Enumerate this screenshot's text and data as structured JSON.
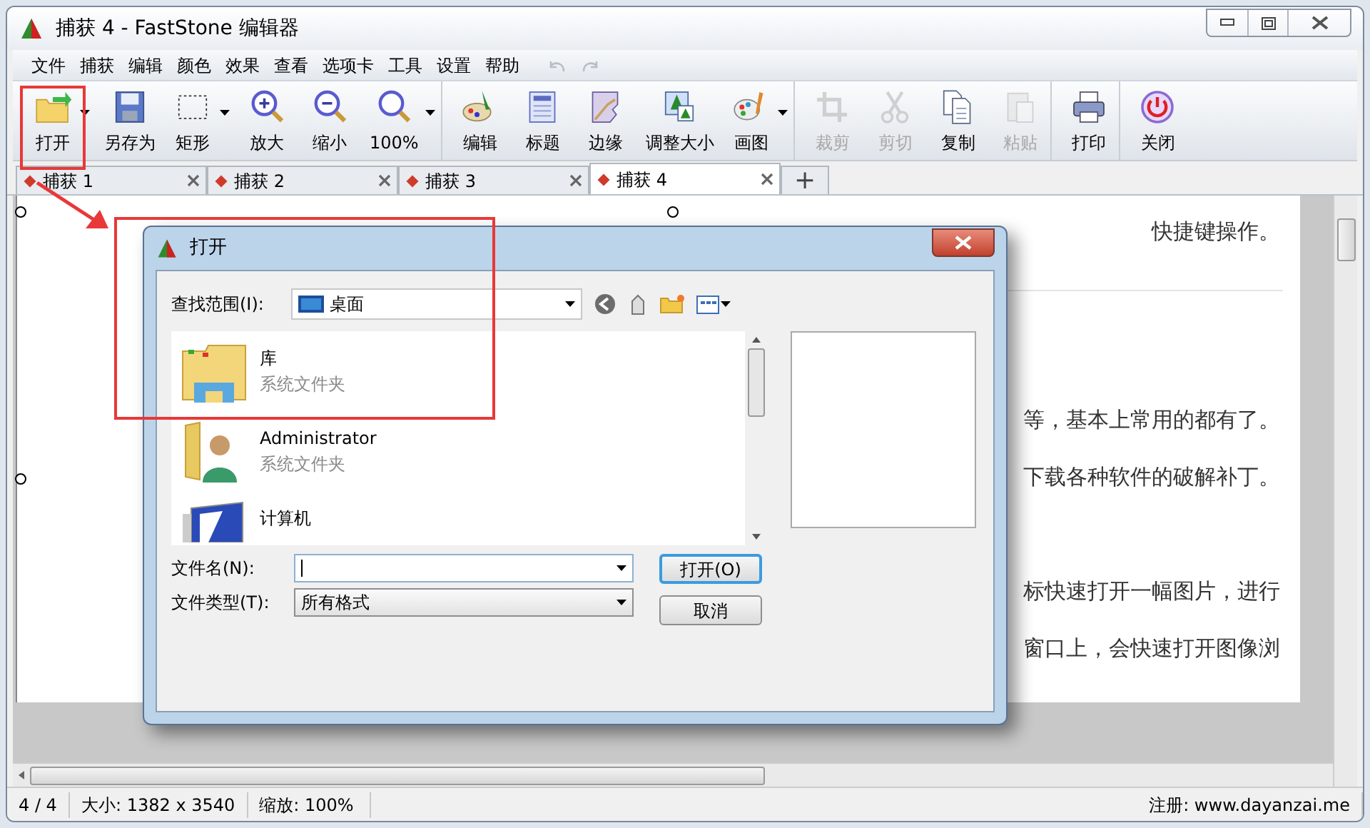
{
  "window": {
    "title": "捕获 4 - FastStone 编辑器"
  },
  "menu": [
    "文件",
    "捕获",
    "编辑",
    "颜色",
    "效果",
    "查看",
    "选项卡",
    "工具",
    "设置",
    "帮助"
  ],
  "toolbar": [
    {
      "label": "打开",
      "disabled": false,
      "dropdown": true,
      "separator_after": false
    },
    {
      "label": "另存为",
      "disabled": false,
      "dropdown": false,
      "separator_after": false
    },
    {
      "label": "矩形",
      "disabled": false,
      "dropdown": true,
      "separator_after": false
    },
    {
      "label": "放大",
      "disabled": false,
      "dropdown": false,
      "separator_after": false
    },
    {
      "label": "缩小",
      "disabled": false,
      "dropdown": false,
      "separator_after": false
    },
    {
      "label": "100%",
      "disabled": false,
      "dropdown": true,
      "separator_after": true
    },
    {
      "label": "编辑",
      "disabled": false,
      "dropdown": false,
      "separator_after": false
    },
    {
      "label": "标题",
      "disabled": false,
      "dropdown": false,
      "separator_after": false
    },
    {
      "label": "边缘",
      "disabled": false,
      "dropdown": false,
      "separator_after": false
    },
    {
      "label": "调整大小",
      "disabled": false,
      "dropdown": false,
      "separator_after": false
    },
    {
      "label": "画图",
      "disabled": false,
      "dropdown": true,
      "separator_after": true
    },
    {
      "label": "裁剪",
      "disabled": true,
      "dropdown": false,
      "separator_after": false
    },
    {
      "label": "剪切",
      "disabled": true,
      "dropdown": false,
      "separator_after": false
    },
    {
      "label": "复制",
      "disabled": false,
      "dropdown": false,
      "separator_after": false
    },
    {
      "label": "粘贴",
      "disabled": true,
      "dropdown": false,
      "separator_after": true
    },
    {
      "label": "打印",
      "disabled": false,
      "dropdown": false,
      "separator_after": true
    },
    {
      "label": "关闭",
      "disabled": false,
      "dropdown": false,
      "separator_after": false
    }
  ],
  "tabs": [
    {
      "label": "捕获 1",
      "selected": false
    },
    {
      "label": "捕获 2",
      "selected": false
    },
    {
      "label": "捕获 3",
      "selected": false
    },
    {
      "label": "捕获 4",
      "selected": true
    }
  ],
  "new_tab": "+",
  "document_lines": [
    "快捷键操作。",
    "等，基本上常用的都有了。",
    "下载各种软件的破解补丁。",
    "标快速打开一幅图片，进行",
    "窗口上，会快速打开图像浏"
  ],
  "dialog": {
    "title": "打开",
    "look_in_label": "查找范围(I):",
    "look_in_value": "桌面",
    "items": [
      {
        "name": "库",
        "type": "系统文件夹"
      },
      {
        "name": "Administrator",
        "type": "系统文件夹"
      },
      {
        "name": "计算机"
      }
    ],
    "file_name_label": "文件名(N):",
    "file_type_label": "文件类型(T):",
    "file_type_value": "所有格式",
    "buttons": [
      {
        "label": "打开(O)",
        "default": true
      },
      {
        "label": "取消",
        "default": false
      }
    ]
  },
  "status_bar": [
    "4 / 4",
    "大小: 1382 x 3540",
    "缩放: 100%",
    "注册: www.dayanzai.me"
  ]
}
